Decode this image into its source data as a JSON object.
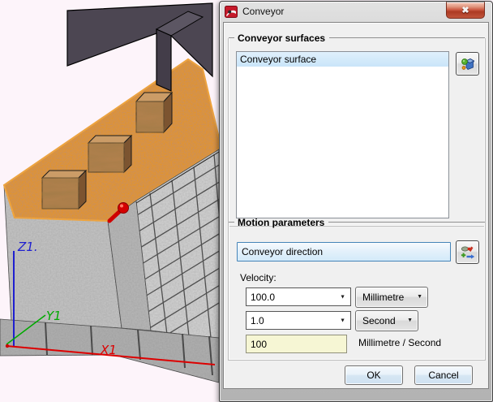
{
  "window": {
    "title": "Conveyor"
  },
  "icons": {
    "close_glyph": "✖",
    "dropdown_arrow": "▼"
  },
  "viewport": {
    "axes": {
      "x": "X1",
      "y": "Y1",
      "z": "Z1."
    },
    "selected_surface_color": "#e8940f",
    "surface_highlight_color": "#ffaa00",
    "axis_colors": {
      "x": "#dd0000",
      "y": "#00aa00",
      "z": "#1f1fd0"
    }
  },
  "surfaces_group": {
    "title": "Conveyor surfaces",
    "items": [
      "Conveyor surface"
    ],
    "selection_color": "#cfe7fa"
  },
  "motion_group": {
    "title": "Motion parameters",
    "direction_value": "Conveyor direction",
    "velocity_label": "Velocity:",
    "distance": {
      "value": "100.0",
      "unit": "Millimetre"
    },
    "time": {
      "value": "1.0",
      "unit": "Second"
    },
    "result": {
      "value": "100",
      "unit_label": "Millimetre / Second"
    }
  },
  "footer": {
    "ok_label": "OK",
    "cancel_label": "Cancel"
  }
}
